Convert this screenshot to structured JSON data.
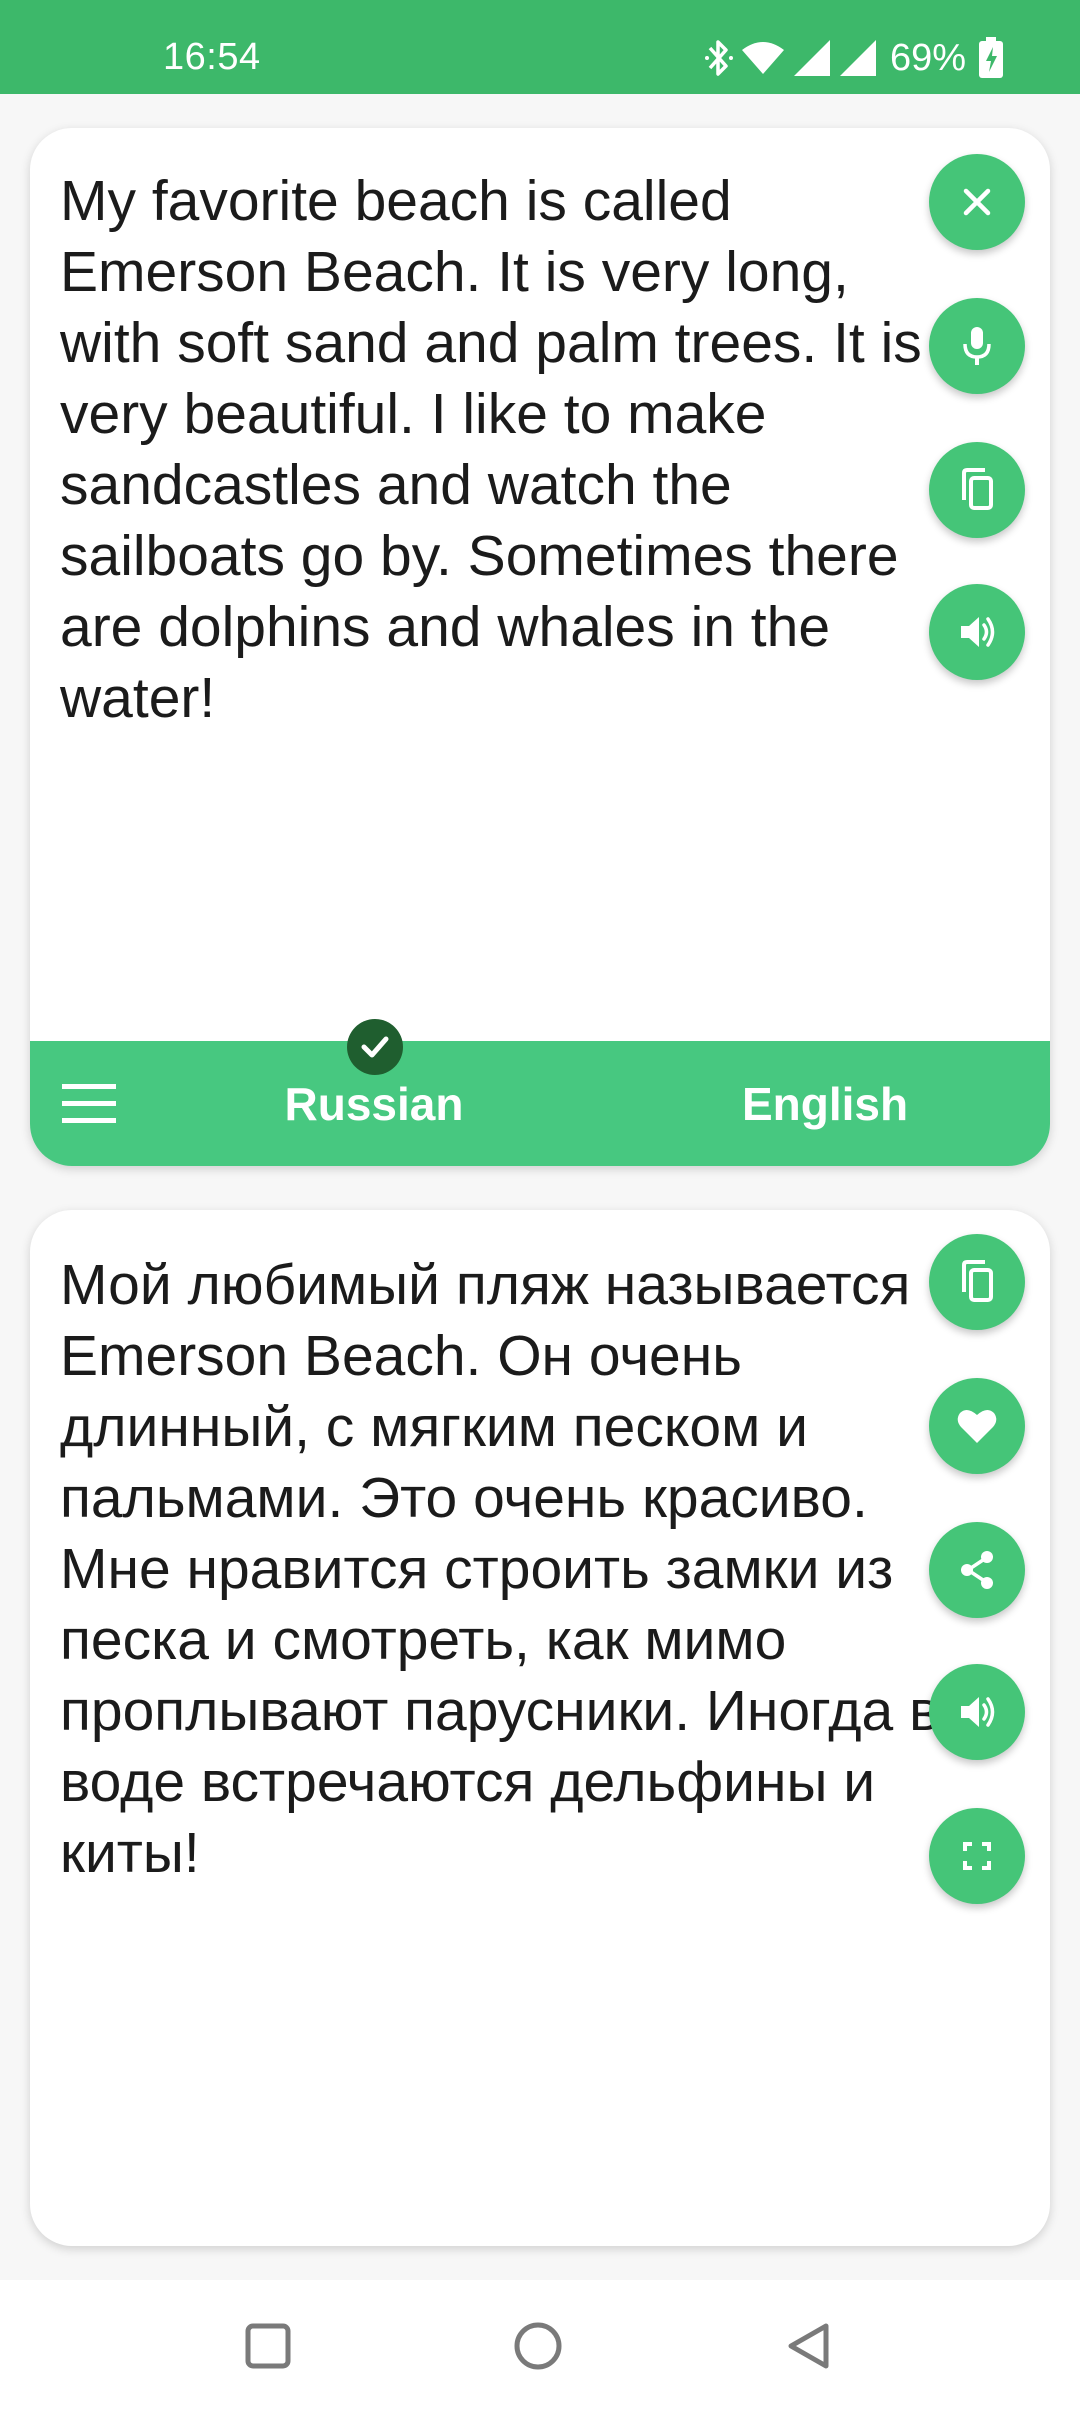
{
  "status_bar": {
    "time": "16:54",
    "battery": "69%",
    "icons": [
      "bluetooth-icon",
      "wifi-icon",
      "signal-icon",
      "signal-icon",
      "battery-charging-icon"
    ]
  },
  "source": {
    "text": "My favorite beach is called Emerson Beach. It is very long, with soft sand and palm trees. It is very beautiful. I like to make sandcastles and watch the sailboats go by. Sometimes there are dolphins and whales in the water!",
    "actions": [
      "close-icon",
      "microphone-icon",
      "copy-icon",
      "speaker-icon"
    ]
  },
  "languages": {
    "source": "Russian",
    "target": "English",
    "selected": "Russian",
    "menu_icon": "menu-icon",
    "selected_icon": "check-icon"
  },
  "target": {
    "text": "Мой любимый пляж называется Emerson Beach. Он очень длинный, с мягким песком и пальмами. Это очень красиво. Мне нравится строить замки из песка и смотреть, как мимо проплывают парусники. Иногда в воде встречаются дельфины и киты!",
    "actions": [
      "copy-icon",
      "heart-icon",
      "share-icon",
      "speaker-icon",
      "fullscreen-icon"
    ]
  },
  "nav_bar": {
    "icons": [
      "recents-square-icon",
      "home-circle-icon",
      "back-triangle-icon"
    ]
  },
  "colors": {
    "status_bar": "#3db86a",
    "accent": "#45c578",
    "lang_bar": "#47c880",
    "check_badge": "#1f5e2f",
    "background": "#f7f7f7",
    "text": "#1b1b1b"
  }
}
